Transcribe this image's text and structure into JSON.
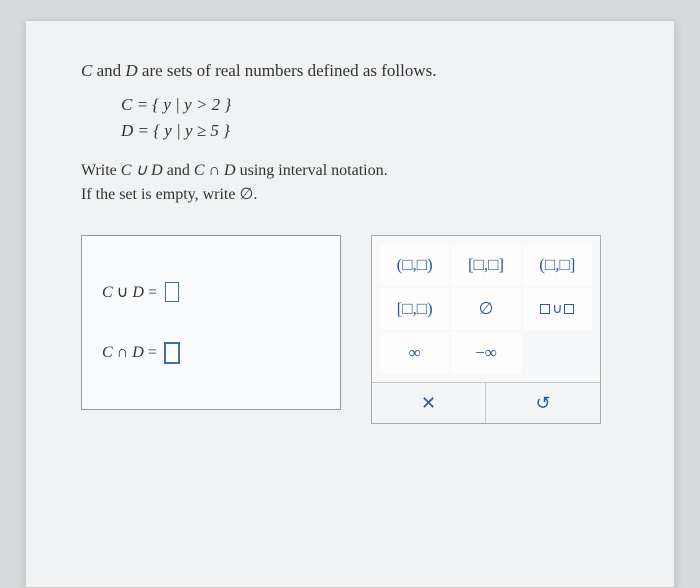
{
  "intro_prefix": "C",
  "intro_mid": " and ",
  "intro_d": "D",
  "intro_suffix": " are sets of real numbers defined as follows.",
  "def_c": "C = { y | y > 2 }",
  "def_d": "D = { y | y ≥ 5 }",
  "instr_line1_a": "Write ",
  "instr_cud": "C ∪ D",
  "instr_line1_b": " and ",
  "instr_cnd": "C ∩ D",
  "instr_line1_c": " using interval notation.",
  "instr_line2": "If the set is empty, write ∅.",
  "answers": {
    "union_label_c": "C",
    "union_label_op": " ∪ ",
    "union_label_d": "D",
    "eq": " = ",
    "inter_label_c": "C",
    "inter_label_op": " ∩ ",
    "inter_label_d": "D"
  },
  "palette": {
    "r0c0": "(□,□)",
    "r0c1": "[□,□]",
    "r0c2": "(□,□]",
    "r1c0": "[□,□)",
    "r1c1": "∅",
    "r2c0": "∞",
    "r2c1": "−∞",
    "foot_clear": "✕",
    "foot_reset": "↺"
  }
}
